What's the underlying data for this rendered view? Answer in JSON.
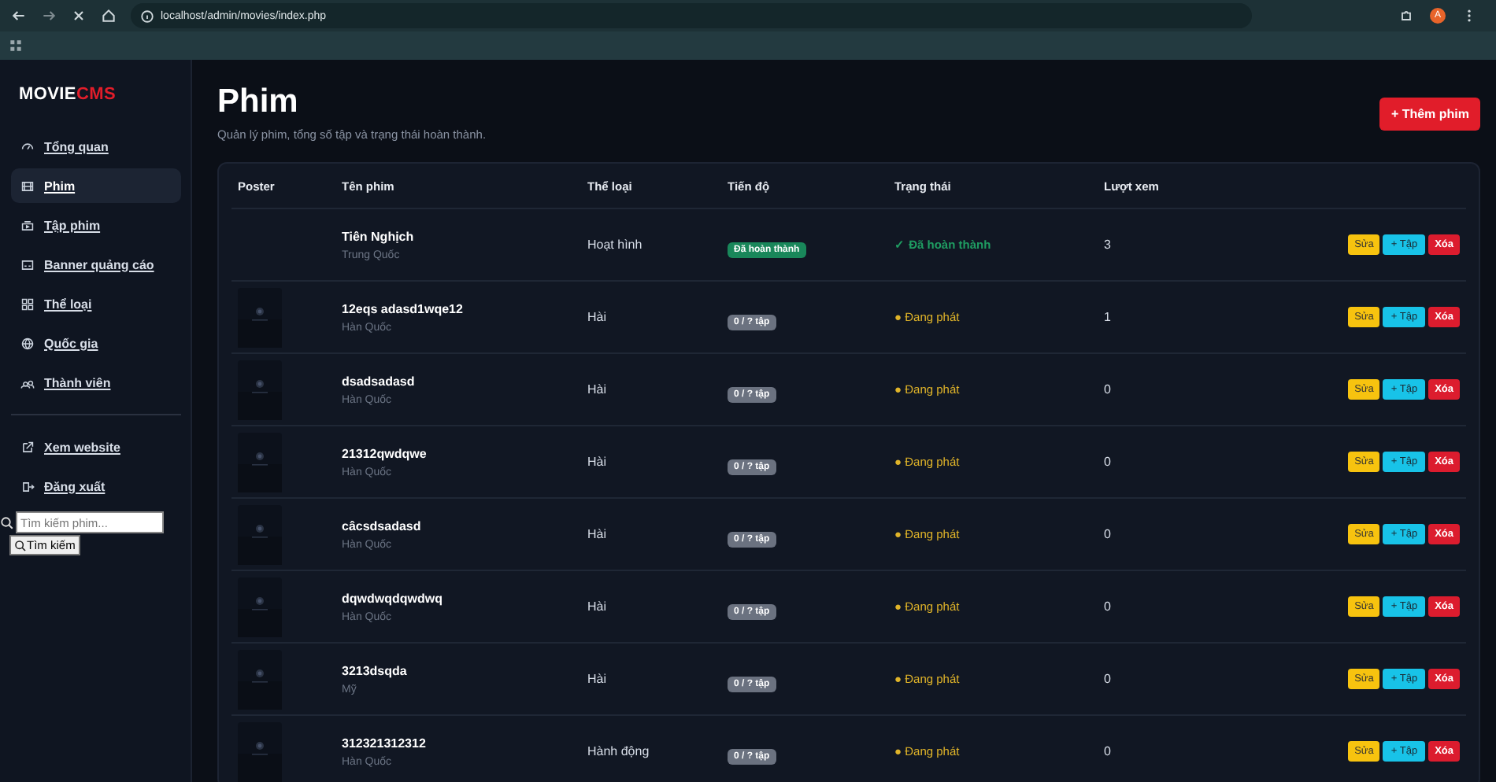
{
  "browser": {
    "url": "localhost/admin/movies/index.php",
    "profile": "A"
  },
  "sidebar": {
    "logo_main": "MOVIE",
    "logo_accent": "CMS",
    "items": [
      {
        "label": "Tổng quan",
        "selected": false
      },
      {
        "label": "Phim",
        "selected": true
      },
      {
        "label": "Tập phim",
        "selected": false
      },
      {
        "label": "Banner quảng cáo",
        "selected": false
      },
      {
        "label": "Thể loại",
        "selected": false
      },
      {
        "label": "Quốc gia",
        "selected": false
      },
      {
        "label": "Thành viên",
        "selected": false
      }
    ],
    "bottom_items": [
      {
        "label": "Xem website"
      },
      {
        "label": "Đăng xuất"
      }
    ],
    "search": {
      "placeholder": "Tìm kiếm phim...",
      "button": "Tìm kiếm"
    }
  },
  "header": {
    "title": "Phim",
    "subtitle": "Quản lý phim, tổng số tập và trạng thái hoàn thành.",
    "add_button": "+ Thêm phim"
  },
  "table": {
    "columns": [
      "Poster",
      "Tên phim",
      "Thể loại",
      "Tiến độ",
      "Trạng thái",
      "Lượt xem"
    ],
    "rows": [
      {
        "has_poster": false,
        "title": "Tiên Nghịch",
        "country": "Trung Quốc",
        "genre": "Hoạt hình",
        "progress": {
          "text": "Đã hoàn thành",
          "kind": "done"
        },
        "status": {
          "text": "✓ Đã hoàn thành",
          "kind": "done"
        },
        "views": "3",
        "actions": [
          {
            "label": "Sửa",
            "kind": "edit"
          },
          {
            "label": "+ Tập",
            "kind": "episode"
          },
          {
            "label": "Xóa",
            "kind": "delete"
          }
        ]
      },
      {
        "has_poster": true,
        "title": "12eqs adasd1wqe12",
        "country": "Hàn Quốc",
        "genre": "Hài",
        "progress": {
          "text": "0 / ? tập",
          "kind": "count"
        },
        "status": {
          "text": "● Đang phát",
          "kind": "airing"
        },
        "views": "1",
        "actions": [
          {
            "label": "Sửa",
            "kind": "edit"
          },
          {
            "label": "+ Tập",
            "kind": "episode"
          },
          {
            "label": "Xóa",
            "kind": "delete"
          }
        ]
      },
      {
        "has_poster": true,
        "title": "dsadsadasd",
        "country": "Hàn Quốc",
        "genre": "Hài",
        "progress": {
          "text": "0 / ? tập",
          "kind": "count"
        },
        "status": {
          "text": "● Đang phát",
          "kind": "airing"
        },
        "views": "0",
        "actions": [
          {
            "label": "Sửa",
            "kind": "edit"
          },
          {
            "label": "+ Tập",
            "kind": "episode"
          },
          {
            "label": "Xóa",
            "kind": "delete"
          }
        ]
      },
      {
        "has_poster": true,
        "title": "21312qwdqwe",
        "country": "Hàn Quốc",
        "genre": "Hài",
        "progress": {
          "text": "0 / ? tập",
          "kind": "count"
        },
        "status": {
          "text": "● Đang phát",
          "kind": "airing"
        },
        "views": "0",
        "actions": [
          {
            "label": "Sửa",
            "kind": "edit"
          },
          {
            "label": "+ Tập",
            "kind": "episode"
          },
          {
            "label": "Xóa",
            "kind": "delete"
          }
        ]
      },
      {
        "has_poster": true,
        "title": "câcsdsadasd",
        "country": "Hàn Quốc",
        "genre": "Hài",
        "progress": {
          "text": "0 / ? tập",
          "kind": "count"
        },
        "status": {
          "text": "● Đang phát",
          "kind": "airing"
        },
        "views": "0",
        "actions": [
          {
            "label": "Sửa",
            "kind": "edit"
          },
          {
            "label": "+ Tập",
            "kind": "episode"
          },
          {
            "label": "Xóa",
            "kind": "delete"
          }
        ]
      },
      {
        "has_poster": true,
        "title": "dqwdwqdqwdwq",
        "country": "Hàn Quốc",
        "genre": "Hài",
        "progress": {
          "text": "0 / ? tập",
          "kind": "count"
        },
        "status": {
          "text": "● Đang phát",
          "kind": "airing"
        },
        "views": "0",
        "actions": [
          {
            "label": "Sửa",
            "kind": "edit"
          },
          {
            "label": "+ Tập",
            "kind": "episode"
          },
          {
            "label": "Xóa",
            "kind": "delete"
          }
        ]
      },
      {
        "has_poster": true,
        "title": "3213dsqda",
        "country": "Mỹ",
        "genre": "Hài",
        "progress": {
          "text": "0 / ? tập",
          "kind": "count"
        },
        "status": {
          "text": "● Đang phát",
          "kind": "airing"
        },
        "views": "0",
        "actions": [
          {
            "label": "Sửa",
            "kind": "edit"
          },
          {
            "label": "+ Tập",
            "kind": "episode"
          },
          {
            "label": "Xóa",
            "kind": "delete"
          }
        ]
      },
      {
        "has_poster": true,
        "title": "312321312312",
        "country": "Hàn Quốc",
        "genre": "Hành động",
        "progress": {
          "text": "0 / ? tập",
          "kind": "count"
        },
        "status": {
          "text": "● Đang phát",
          "kind": "airing"
        },
        "views": "0",
        "actions": [
          {
            "label": "Sửa",
            "kind": "edit"
          },
          {
            "label": "+ Tập",
            "kind": "episode"
          },
          {
            "label": "Xóa",
            "kind": "delete"
          }
        ]
      }
    ]
  }
}
